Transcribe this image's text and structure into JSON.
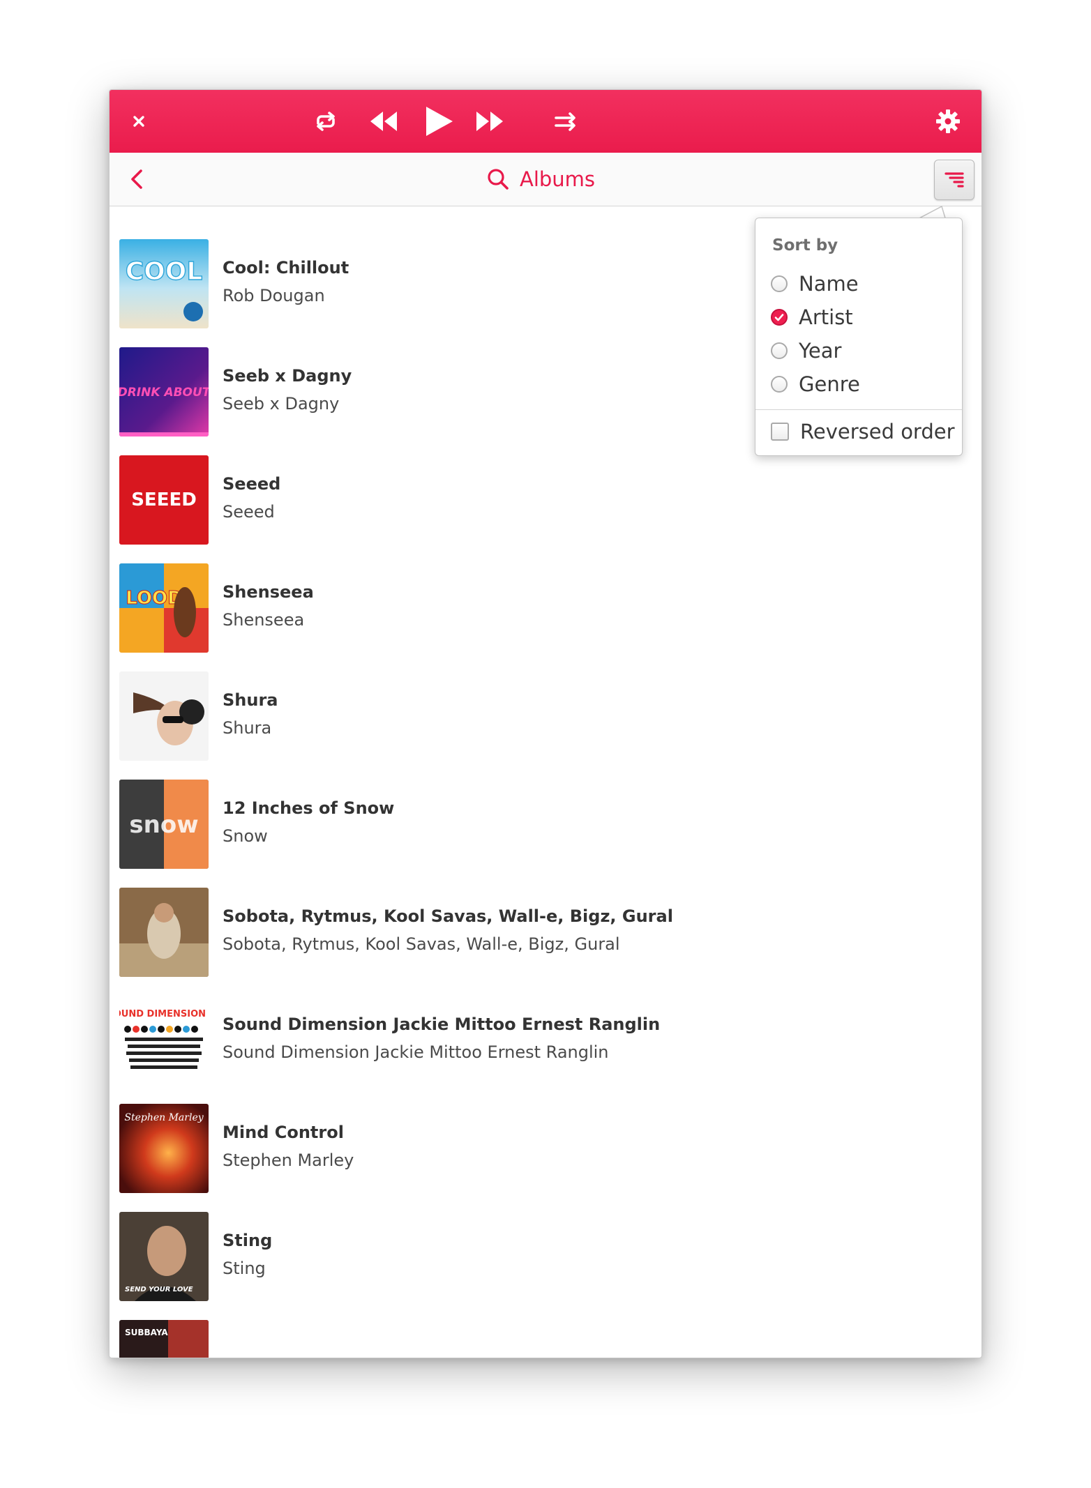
{
  "header": {
    "title": "Albums"
  },
  "sort_popover": {
    "heading": "Sort by",
    "options": [
      {
        "label": "Name",
        "selected": false
      },
      {
        "label": "Artist",
        "selected": true
      },
      {
        "label": "Year",
        "selected": false
      },
      {
        "label": "Genre",
        "selected": false
      }
    ],
    "reversed_label": "Reversed order",
    "reversed_checked": false
  },
  "albums": [
    {
      "title": "Cool: Chillout",
      "artist": "Rob Dougan",
      "cover_text": "COOL"
    },
    {
      "title": "Seeb x Dagny",
      "artist": "Seeb x Dagny",
      "cover_text": "DRINK ABOUT"
    },
    {
      "title": "Seeed",
      "artist": "Seeed",
      "cover_text": "SEEED"
    },
    {
      "title": "Shenseea",
      "artist": "Shenseea",
      "cover_text": "LOOD"
    },
    {
      "title": "Shura",
      "artist": "Shura",
      "cover_text": ""
    },
    {
      "title": "12 Inches of Snow",
      "artist": "Snow",
      "cover_text": "snow"
    },
    {
      "title": "Sobota, Rytmus, Kool Savas, Wall-e, Bigz, Gural",
      "artist": "Sobota, Rytmus, Kool Savas, Wall-e, Bigz, Gural",
      "cover_text": ""
    },
    {
      "title": "Sound Dimension Jackie Mittoo Ernest Ranglin",
      "artist": "Sound Dimension Jackie Mittoo Ernest Ranglin",
      "cover_text": "SOUND DIMENSION"
    },
    {
      "title": "Mind Control",
      "artist": "Stephen Marley",
      "cover_text": "Stephen Marley"
    },
    {
      "title": "Sting",
      "artist": "Sting",
      "cover_text": "SEND YOUR LOVE"
    },
    {
      "title": "",
      "artist": "",
      "cover_text": "SUBBAYA"
    }
  ],
  "colors": {
    "accent": "#ea1c4c",
    "text": "#333333",
    "subtext": "#4a4a4a"
  }
}
